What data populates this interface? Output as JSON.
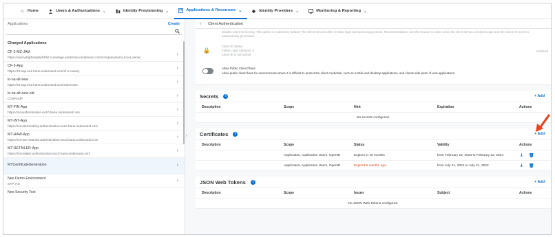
{
  "nav": {
    "items": [
      {
        "icon": "home-icon",
        "label": "Home",
        "chevron": false,
        "active": false
      },
      {
        "icon": "users-icon",
        "label": "Users & Authorizations",
        "chevron": true,
        "active": false
      },
      {
        "icon": "provisioning-icon",
        "label": "Identity Provisioning",
        "chevron": true,
        "active": false
      },
      {
        "icon": "applications-icon",
        "label": "Applications & Resources",
        "chevron": true,
        "active": true
      },
      {
        "icon": "identity-providers-icon",
        "label": "Identity Providers",
        "chevron": true,
        "active": false
      },
      {
        "icon": "monitoring-icon",
        "label": "Monitoring & Reporting",
        "chevron": true,
        "active": false
      }
    ]
  },
  "left": {
    "title": "Applications",
    "create": "Create",
    "group": "Charged Applications",
    "apps": [
      {
        "name": "CF-2-MZ-JAM",
        "sub": "https://vamiv4rgt0aw/ptyfvfdxf.corestage.workzone.ondemand.com/company/saml_local_servic..."
      },
      {
        "name": "CF-3-App",
        "sub": "https://rrt-sap.eu2.hana.ondemand.com/cf-s-canary"
      },
      {
        "name": "lo-na-alt-new",
        "sub": "https://rrt-sap.eu2.hana.ondemand.com/r0pem46c"
      },
      {
        "name": "lo-na-alt-new-old",
        "sub": "CONN-IdP"
      },
      {
        "name": "MT-FIN-App",
        "sub": "https://mt-authentication.eu10.hana.ondemand.com"
      },
      {
        "name": "MT-INT-App",
        "sub": "https://mt-intermediary.authentication.eu10.hana.ondemand.com"
      },
      {
        "name": "MT-RAW-App",
        "sub": "https://mt-raw-material.authentication.eu10.hana.ondemand.com"
      },
      {
        "name": "MT-RETAILER-App",
        "sub": "https://mt-retailer.authentication.eu10.hana.ondemand.com"
      },
      {
        "name": "MTCertificateGeneration",
        "sub": ""
      },
      {
        "name": "Neo Demo Environment",
        "sub": "SAP IAS"
      },
      {
        "name": "Neo Security Tool",
        "sub": ""
      }
    ]
  },
  "right": {
    "breadcrumb": "Client Authentication",
    "auth": {
      "row1": "Disable Client ID locking. This option is enabled by default. The Client ID locks after 5 failed login attempts using secrets. Recommendation: use this feature in cases when the client ID has a limited scope and the Client ID secret is automatically generated.",
      "row2_title": "Client ID Status",
      "row2_a": "Failed Login Attempts: 0",
      "row2_b": "Client ID is not locked",
      "unlocked": "Unlocked",
      "row3_title": "Allow Public Client Flows",
      "row3_desc": "Allow public client flows for environments where it is difficult to protect the client credential, such as mobile and desktop applications, and clients-side parts of web applications."
    },
    "secrets": {
      "title": "Secrets",
      "add": "+ Add",
      "columns": [
        "Description",
        "Scope",
        "Hint",
        "Expiration",
        "Actions"
      ],
      "empty": "No secrets configured."
    },
    "certificates": {
      "title": "Certificates",
      "add": "+ Add",
      "columns": [
        "Description",
        "Scope",
        "Status",
        "Validity",
        "Actions"
      ],
      "rows": [
        {
          "scope": "Application, Application Users, OpenID",
          "status": "Expires in 10 months",
          "validity": "from February 22, 2023 to February 22, 2024",
          "expired": false
        },
        {
          "scope": "Application, Application Users, OpenID",
          "status": "Expired 6 months ago",
          "validity": "from July 21, 2021 to July 21, 2022",
          "expired": true
        }
      ]
    },
    "jwt": {
      "title": "JSON Web Tokens",
      "add": "+ Add",
      "columns": [
        "Description",
        "Scope",
        "Issuer",
        "Subject",
        "Actions"
      ],
      "empty": "No JSON Web Tokens configured."
    }
  },
  "colors": {
    "accent": "#0a6ed1",
    "annotation": "#e9421a",
    "text": "#32363a"
  }
}
